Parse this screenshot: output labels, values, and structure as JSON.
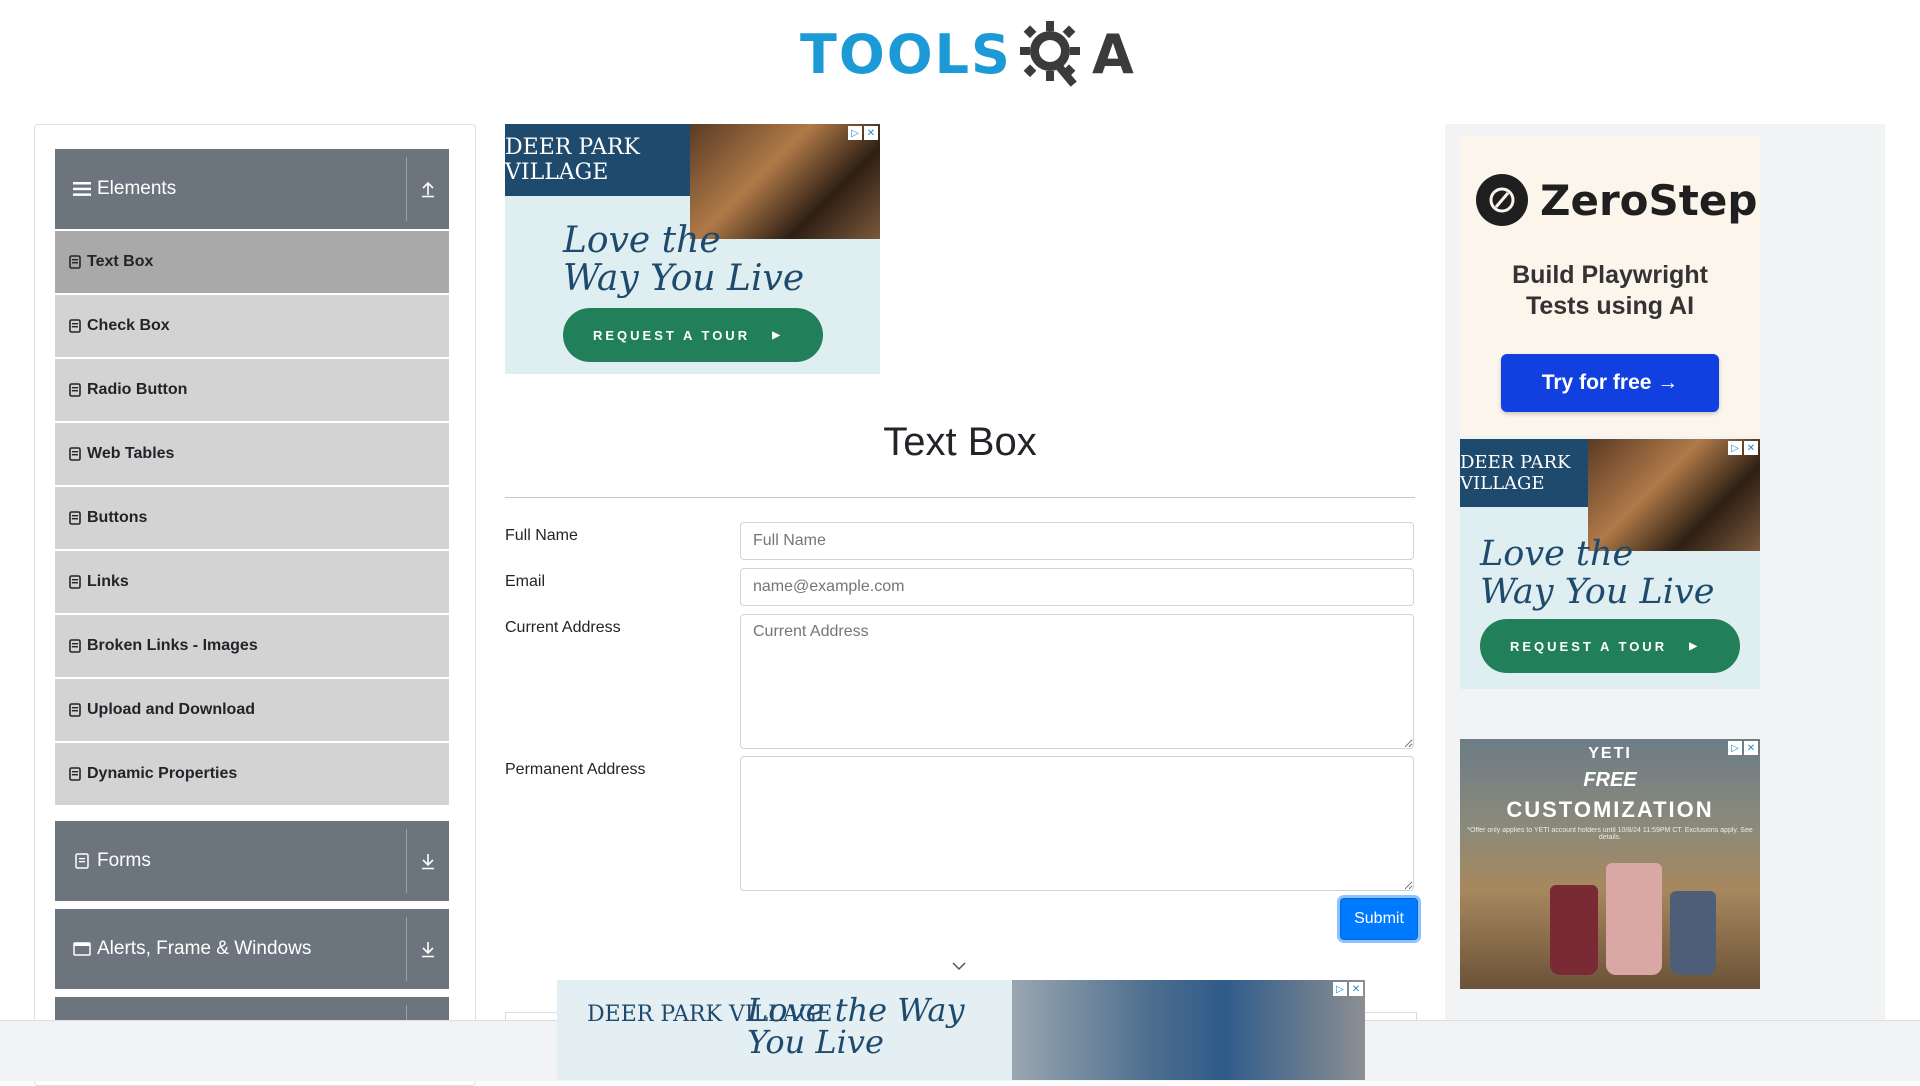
{
  "header": {
    "logo_text_tools": "TOOLS",
    "logo_text_qa": "A"
  },
  "sidebar": {
    "groups": [
      {
        "label": "Elements",
        "expanded": true
      },
      {
        "label": "Forms",
        "expanded": false
      },
      {
        "label": "Alerts, Frame & Windows",
        "expanded": false
      }
    ],
    "items": [
      {
        "label": "Text Box",
        "active": true
      },
      {
        "label": "Check Box"
      },
      {
        "label": "Radio Button"
      },
      {
        "label": "Web Tables"
      },
      {
        "label": "Buttons"
      },
      {
        "label": "Links"
      },
      {
        "label": "Broken Links - Images"
      },
      {
        "label": "Upload and Download"
      },
      {
        "label": "Dynamic Properties"
      }
    ]
  },
  "ad_top": {
    "brand": "DEER PARK VILLAGE",
    "headline_1": "Love the",
    "headline_2": "Way You Live",
    "cta": "REQUEST A TOUR"
  },
  "main": {
    "title": "Text Box",
    "fields": [
      {
        "label": "Full Name",
        "placeholder": "Full Name"
      },
      {
        "label": "Email",
        "placeholder": "name@example.com"
      },
      {
        "label": "Current Address",
        "placeholder": "Current Address"
      },
      {
        "label": "Permanent Address",
        "placeholder": ""
      }
    ],
    "submit_label": "Submit"
  },
  "ad_zerostep": {
    "brand": "ZeroStep",
    "line1": "Build Playwright",
    "line2": "Tests using AI",
    "cta": "Try for free →"
  },
  "ad_right2": {
    "brand": "DEER PARK VILLAGE",
    "headline_1": "Love the",
    "headline_2": "Way You Live",
    "cta": "REQUEST A TOUR"
  },
  "ad_yeti": {
    "brand": "YETI",
    "free": "FREE",
    "headline": "CUSTOMIZATION",
    "fine_print": "*Offer only applies to YETI account holders until 10/8/24 11:59PM CT. Exclusions apply. See details."
  },
  "ad_bottom": {
    "brand": "DEER PARK VILLAGE",
    "headline_1": "Love the Way",
    "headline_2": "You Live"
  },
  "colors": {
    "accent": "#007bff",
    "sidebar_header": "#6c757d",
    "sidebar_item": "#d3d3d3",
    "sidebar_item_active": "#a9a9a9",
    "logo_blue": "#1b9ad6"
  }
}
